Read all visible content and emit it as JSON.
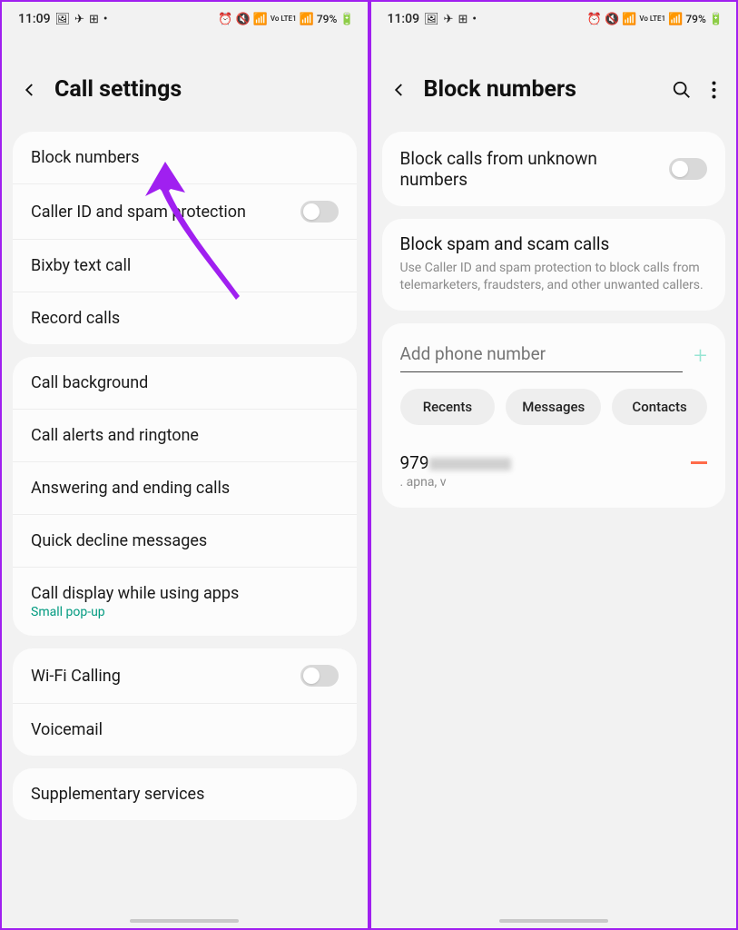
{
  "status": {
    "time": "11:09",
    "battery": "79%",
    "lte": "Vo LTE1"
  },
  "left": {
    "title": "Call settings",
    "group1": [
      {
        "label": "Block numbers",
        "toggle": null
      },
      {
        "label": "Caller ID and spam protection",
        "toggle": "off"
      },
      {
        "label": "Bixby text call",
        "toggle": null
      },
      {
        "label": "Record calls",
        "toggle": null
      }
    ],
    "group2": [
      {
        "label": "Call background",
        "sub": null
      },
      {
        "label": "Call alerts and ringtone",
        "sub": null
      },
      {
        "label": "Answering and ending calls",
        "sub": null
      },
      {
        "label": "Quick decline messages",
        "sub": null
      },
      {
        "label": "Call display while using apps",
        "sub": "Small pop-up"
      }
    ],
    "group3": [
      {
        "label": "Wi-Fi Calling",
        "toggle": "off"
      },
      {
        "label": "Voicemail",
        "toggle": null
      }
    ],
    "group4": [
      {
        "label": "Supplementary services"
      }
    ]
  },
  "right": {
    "title": "Block numbers",
    "block_unknown": {
      "label": "Block calls from unknown numbers",
      "toggle": "off"
    },
    "block_spam": {
      "title": "Block spam and scam calls",
      "desc": "Use Caller ID and spam protection to block calls from telemarketers, fraudsters, and other unwanted callers."
    },
    "add_placeholder": "Add phone number",
    "chips": {
      "recents": "Recents",
      "messages": "Messages",
      "contacts": "Contacts"
    },
    "blocked": {
      "number_prefix": "979",
      "sub": ". apna, v"
    }
  }
}
